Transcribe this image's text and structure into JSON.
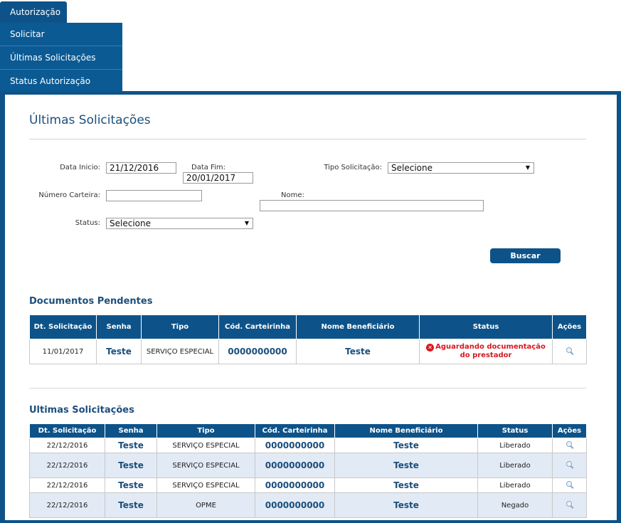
{
  "menu": {
    "top_tab": "Autorização",
    "items": [
      "Solicitar",
      "Últimas Solicitações",
      "Status Autorização"
    ]
  },
  "page": {
    "title": "Últimas Solicitações"
  },
  "filters": {
    "data_inicio_label": "Data Inicio:",
    "data_inicio_value": "21/12/2016",
    "data_fim_label": "Data Fim:",
    "data_fim_value": "20/01/2017",
    "tipo_label": "Tipo Solicitação:",
    "tipo_value": "Selecione",
    "carteira_label": "Número Carteira:",
    "carteira_value": "",
    "nome_label": "Nome:",
    "nome_value": "",
    "status_label": "Status:",
    "status_value": "Selecione",
    "buscar_label": "Buscar"
  },
  "pendentes": {
    "title": "Documentos Pendentes",
    "headers": [
      "Dt. Solicitação",
      "Senha",
      "Tipo",
      "Cód. Carteirinha",
      "Nome Beneficiário",
      "Status",
      "Ações"
    ],
    "rows": [
      {
        "data": "11/01/2017",
        "senha": "Teste",
        "tipo": "SERVIÇO ESPECIAL",
        "cod": "0000000000",
        "nome": "Teste",
        "status": "Aguardando documentação do prestador"
      }
    ]
  },
  "ultimas": {
    "title": "Ultimas Solicitações",
    "headers": [
      "Dt. Solicitação",
      "Senha",
      "Tipo",
      "Cód. Carteirinha",
      "Nome Beneficiário",
      "Status",
      "Ações"
    ],
    "rows": [
      {
        "data": "22/12/2016",
        "senha": "Teste",
        "tipo": "SERVIÇO ESPECIAL",
        "cod": "0000000000",
        "nome": "Teste",
        "status": "Liberado"
      },
      {
        "data": "22/12/2016",
        "senha": "Teste",
        "tipo": "SERVIÇO ESPECIAL",
        "cod": "0000000000",
        "nome": "Teste",
        "status": "Liberado"
      },
      {
        "data": "22/12/2016",
        "senha": "Teste",
        "tipo": "SERVIÇO ESPECIAL",
        "cod": "0000000000",
        "nome": "Teste",
        "status": "Liberado"
      },
      {
        "data": "22/12/2016",
        "senha": "Teste",
        "tipo": "OPME",
        "cod": "0000000000",
        "nome": "Teste",
        "status": "Negado"
      }
    ]
  },
  "icons": {
    "action": "magnifier-icon",
    "error": "error-circle-icon"
  },
  "colors": {
    "brand": "#0d5389",
    "error": "#d6181e",
    "alt_row": "#e2eaf5"
  }
}
